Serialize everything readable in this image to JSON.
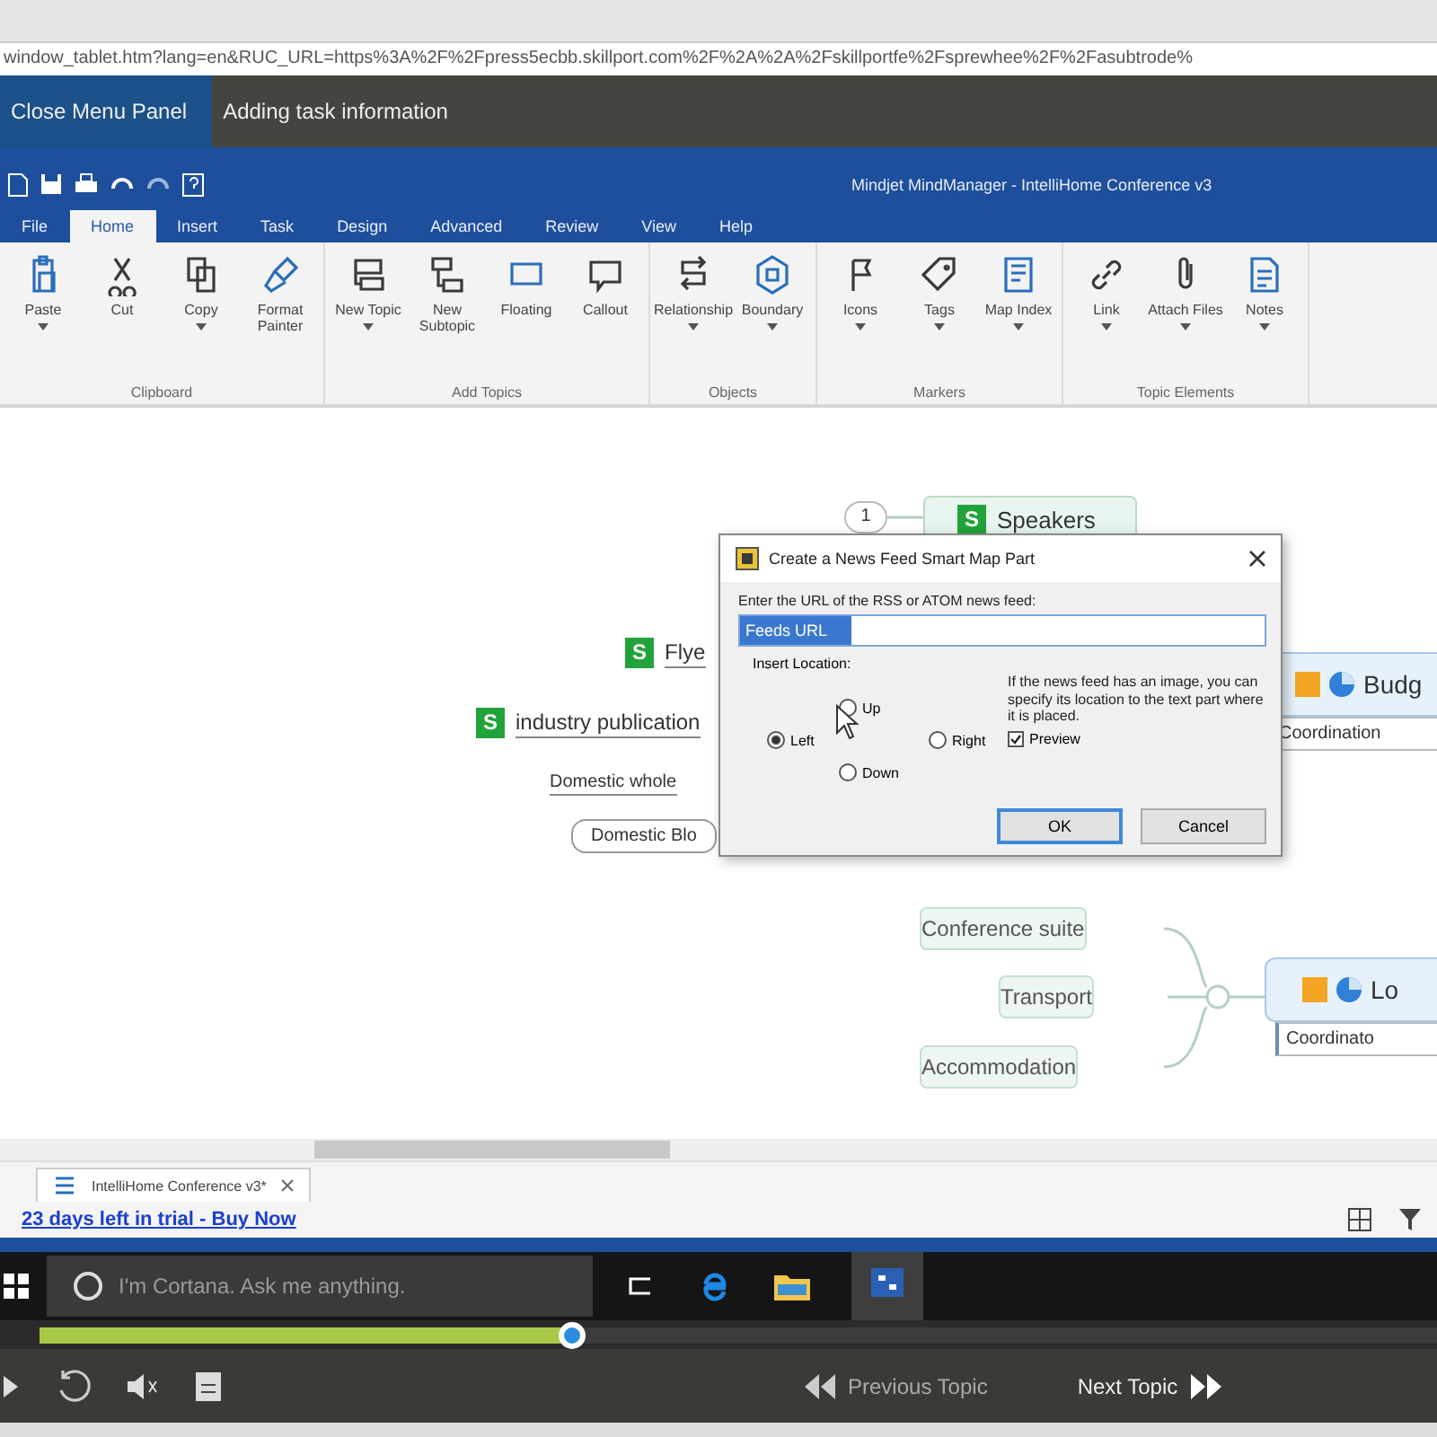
{
  "browser": {
    "url": "window_tablet.htm?lang=en&RUC_URL=https%3A%2F%2Fpress5ecbb.skillport.com%2F%2A%2A%2Fskillportfe%2Fsprewhee%2F%2Fasubtrode%"
  },
  "lesson_bar": {
    "tabs": [
      {
        "label": "Close Menu Panel",
        "selected": true
      },
      {
        "label": "Adding task information",
        "selected": false
      }
    ]
  },
  "app": {
    "title": "Mindjet MindManager - IntelliHome Conference v3"
  },
  "ribbon": {
    "tabs": [
      {
        "label": "File",
        "selected": false
      },
      {
        "label": "Home",
        "selected": true
      },
      {
        "label": "Insert",
        "selected": false
      },
      {
        "label": "Task",
        "selected": false
      },
      {
        "label": "Design",
        "selected": false
      },
      {
        "label": "Advanced",
        "selected": false
      },
      {
        "label": "Review",
        "selected": false
      },
      {
        "label": "View",
        "selected": false
      },
      {
        "label": "Help",
        "selected": false
      }
    ],
    "groups": [
      {
        "label": "Clipboard",
        "buttons": [
          {
            "label": "Paste",
            "dropdown": true
          },
          {
            "label": "Cut",
            "dropdown": false
          },
          {
            "label": "Copy",
            "dropdown": true
          },
          {
            "label": "Format Painter",
            "dropdown": false
          }
        ]
      },
      {
        "label": "Add Topics",
        "buttons": [
          {
            "label": "New Topic",
            "dropdown": true
          },
          {
            "label": "New Subtopic",
            "dropdown": false
          },
          {
            "label": "Floating",
            "dropdown": false
          },
          {
            "label": "Callout",
            "dropdown": false
          }
        ]
      },
      {
        "label": "Objects",
        "buttons": [
          {
            "label": "Relationship",
            "dropdown": true
          },
          {
            "label": "Boundary",
            "dropdown": true
          }
        ]
      },
      {
        "label": "Markers",
        "buttons": [
          {
            "label": "Icons",
            "dropdown": true
          },
          {
            "label": "Tags",
            "dropdown": true
          },
          {
            "label": "Map Index",
            "dropdown": true
          }
        ]
      },
      {
        "label": "Topic Elements",
        "buttons": [
          {
            "label": "Link",
            "dropdown": true
          },
          {
            "label": "Attach Files",
            "dropdown": true
          },
          {
            "label": "Notes",
            "dropdown": true
          }
        ]
      }
    ]
  },
  "map": {
    "nodes": [
      {
        "kind": "badge",
        "text": "1"
      },
      {
        "kind": "topic",
        "marker": "S",
        "text": "Speakers"
      },
      {
        "kind": "line",
        "marker": "S",
        "text": "Flye"
      },
      {
        "kind": "line",
        "marker": "S",
        "text": "industry publication"
      },
      {
        "kind": "plain",
        "text": "Domestic whole"
      },
      {
        "kind": "box",
        "text": "Domestic Blo"
      },
      {
        "kind": "central",
        "text": "Budg",
        "note": "Coordination"
      },
      {
        "kind": "subtopic",
        "text": "Conference suite"
      },
      {
        "kind": "subtopic",
        "text": "Transport"
      },
      {
        "kind": "subtopic",
        "text": "Accommodation"
      },
      {
        "kind": "central",
        "text": "Lo",
        "note": "Coordinato"
      }
    ]
  },
  "dialog": {
    "title": "Create a News Feed Smart Map Part",
    "prompt": "Enter the URL of the RSS or ATOM news feed:",
    "value": "Feeds URL",
    "group_label": "Insert Location:",
    "radios": [
      {
        "label": "Up",
        "selected": false
      },
      {
        "label": "Left",
        "selected": true
      },
      {
        "label": "Right",
        "selected": false
      },
      {
        "label": "Down",
        "selected": false
      }
    ],
    "hint": "If the news feed has an image, you can specify its location to the text part where it is placed.",
    "preview": {
      "label": "Preview",
      "checked": true
    },
    "buttons": [
      "OK",
      "Cancel"
    ]
  },
  "document_tab": {
    "label": "IntelliHome Conference v3*"
  },
  "trial": {
    "link": "23 days left in trial - Buy Now"
  },
  "taskbar": {
    "search_placeholder": "I'm Cortana. Ask me anything."
  },
  "player": {
    "level": 0.38,
    "previous": "Previous Topic",
    "next": "Next Topic"
  }
}
